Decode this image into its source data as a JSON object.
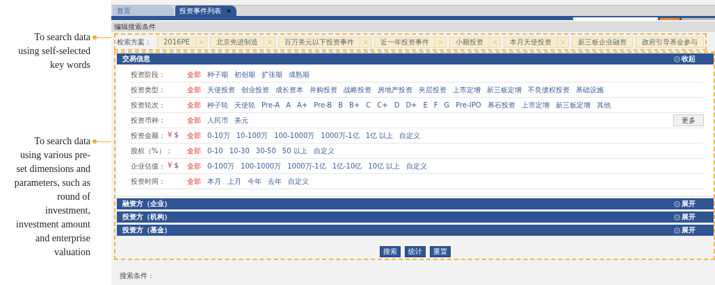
{
  "annotations": [
    {
      "text": "To search data using self-selected key words"
    },
    {
      "text": "To search data using various pre-set dimensions and parameters, such as round of investment, investment amount and enterprise valuation"
    }
  ],
  "tabs": [
    {
      "label": "首页",
      "selected": false
    },
    {
      "label": "投资事件列表",
      "selected": true
    }
  ],
  "section_title": "编辑搜索条件",
  "saved_searches": {
    "label": "检索方案：",
    "items": [
      {
        "label": "2016PE",
        "removable": true
      },
      {
        "label": "北京先进制造",
        "removable": true
      },
      {
        "label": "百万美元以下投资事件",
        "removable": true
      },
      {
        "label": "近一年投资事件",
        "removable": true
      },
      {
        "label": "小额投资",
        "removable": true
      },
      {
        "label": "本月天使投资",
        "removable": true
      },
      {
        "label": "新三板企业融资",
        "removable": false
      },
      {
        "label": "政府引导基金参与",
        "removable": false
      }
    ]
  },
  "panels": [
    {
      "title": "交易信息",
      "expanded": true,
      "toggle": "收起",
      "filters": [
        {
          "label": "投资阶段：",
          "options": [
            {
              "label": "全部",
              "selected": true
            },
            {
              "label": "种子期",
              "selected": false
            },
            {
              "label": "初创期",
              "selected": false
            },
            {
              "label": "扩张期",
              "selected": false
            },
            {
              "label": "成熟期",
              "selected": false
            }
          ]
        },
        {
          "label": "投资类型：",
          "options": [
            {
              "label": "全部",
              "selected": true
            },
            {
              "label": "天使投资",
              "selected": false
            },
            {
              "label": "创业投资",
              "selected": false
            },
            {
              "label": "成长资本",
              "selected": false
            },
            {
              "label": "并购投资",
              "selected": false
            },
            {
              "label": "战略投资",
              "selected": false
            },
            {
              "label": "房地产投资",
              "selected": false
            },
            {
              "label": "夹层投资",
              "selected": false
            },
            {
              "label": "上市定增",
              "selected": false
            },
            {
              "label": "新三板定增",
              "selected": false
            },
            {
              "label": "不良债权投资",
              "selected": false
            },
            {
              "label": "基础设施",
              "selected": false
            }
          ]
        },
        {
          "label": "投资轮次：",
          "options": [
            {
              "label": "全部",
              "selected": true
            },
            {
              "label": "种子轮",
              "selected": false
            },
            {
              "label": "天使轮",
              "selected": false
            },
            {
              "label": "Pre-A",
              "selected": false
            },
            {
              "label": "A",
              "selected": false
            },
            {
              "label": "A+",
              "selected": false
            },
            {
              "label": "Pre-B",
              "selected": false
            },
            {
              "label": "B",
              "selected": false
            },
            {
              "label": "B+",
              "selected": false
            },
            {
              "label": "C",
              "selected": false
            },
            {
              "label": "C+",
              "selected": false
            },
            {
              "label": "D",
              "selected": false
            },
            {
              "label": "D+",
              "selected": false
            },
            {
              "label": "E",
              "selected": false
            },
            {
              "label": "F",
              "selected": false
            },
            {
              "label": "G",
              "selected": false
            },
            {
              "label": "Pre-IPO",
              "selected": false
            },
            {
              "label": "基石投资",
              "selected": false
            },
            {
              "label": "上市定增",
              "selected": false
            },
            {
              "label": "新三板定增",
              "selected": false
            },
            {
              "label": "其他",
              "selected": false
            }
          ]
        },
        {
          "label": "投资币种：",
          "options": [
            {
              "label": "全部",
              "selected": true
            },
            {
              "label": "人民币",
              "selected": false
            },
            {
              "label": "美元",
              "selected": false
            }
          ],
          "more_button": "更多"
        },
        {
          "label": "投资金额：",
          "currencies": [
            {
              "symbol": "¥",
              "selected": true
            },
            {
              "symbol": "$",
              "selected": false
            }
          ],
          "options": [
            {
              "label": "全部",
              "selected": true
            },
            {
              "label": "0-10万",
              "selected": false
            },
            {
              "label": "10-100万",
              "selected": false
            },
            {
              "label": "100-1000万",
              "selected": false
            },
            {
              "label": "1000万-1亿",
              "selected": false
            },
            {
              "label": "1亿 以上",
              "selected": false
            },
            {
              "label": "自定义",
              "selected": false
            }
          ]
        },
        {
          "label": "股权（%）：",
          "options": [
            {
              "label": "全部",
              "selected": true
            },
            {
              "label": "0-10",
              "selected": false
            },
            {
              "label": "10-30",
              "selected": false
            },
            {
              "label": "30-50",
              "selected": false
            },
            {
              "label": "50 以上",
              "selected": false
            },
            {
              "label": "自定义",
              "selected": false
            }
          ]
        },
        {
          "label": "企业估值：",
          "currencies": [
            {
              "symbol": "¥",
              "selected": true
            },
            {
              "symbol": "$",
              "selected": false
            }
          ],
          "options": [
            {
              "label": "全部",
              "selected": true
            },
            {
              "label": "0-100万",
              "selected": false
            },
            {
              "label": "100-1000万",
              "selected": false
            },
            {
              "label": "1000万-1亿",
              "selected": false
            },
            {
              "label": "1亿-10亿",
              "selected": false
            },
            {
              "label": "10亿 以上",
              "selected": false
            },
            {
              "label": "自定义",
              "selected": false
            }
          ]
        },
        {
          "label": "投资时间：",
          "options": [
            {
              "label": "全部",
              "selected": true
            },
            {
              "label": "本月",
              "selected": false
            },
            {
              "label": "上月",
              "selected": false
            },
            {
              "label": "今年",
              "selected": false
            },
            {
              "label": "去年",
              "selected": false
            },
            {
              "label": "自定义",
              "selected": false
            }
          ]
        }
      ]
    },
    {
      "title": "融资方（企业）",
      "expanded": false,
      "toggle": "展开"
    },
    {
      "title": "投资方（机构）",
      "expanded": false,
      "toggle": "展开"
    },
    {
      "title": "投资方（基金）",
      "expanded": false,
      "toggle": "展开"
    }
  ],
  "buttons": [
    "搜索",
    "统计",
    "重置"
  ],
  "search_conditions_label": "搜索条件："
}
